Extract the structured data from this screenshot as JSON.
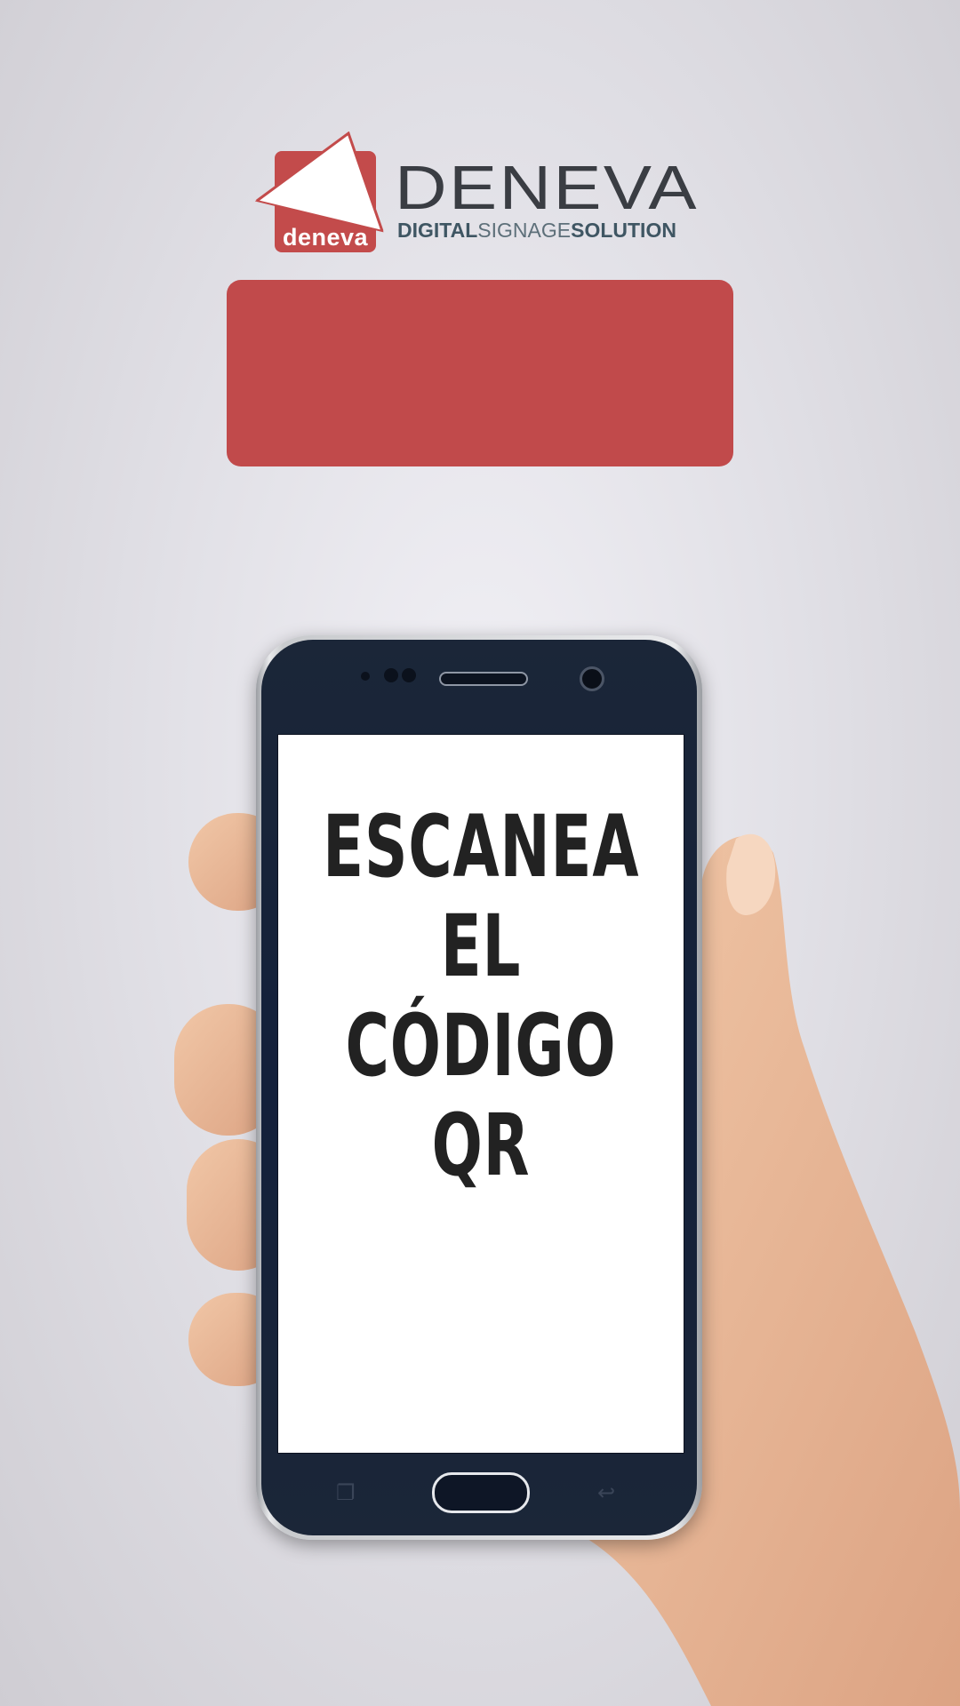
{
  "logo": {
    "mark_text": "deneva",
    "brand_name": "DENEVA",
    "tagline_parts": [
      "DIGITAL",
      "SIGNAGE",
      "SOLUTION"
    ]
  },
  "banner": {
    "color": "#c14a4b",
    "text": ""
  },
  "phone": {
    "screen_title_line1": "ESCANEA EL",
    "screen_title_line2": "CÓDIGO QR",
    "body_color": "#13203a"
  },
  "icons": {
    "recent_apps": "recent-apps-icon",
    "back": "back-icon"
  }
}
